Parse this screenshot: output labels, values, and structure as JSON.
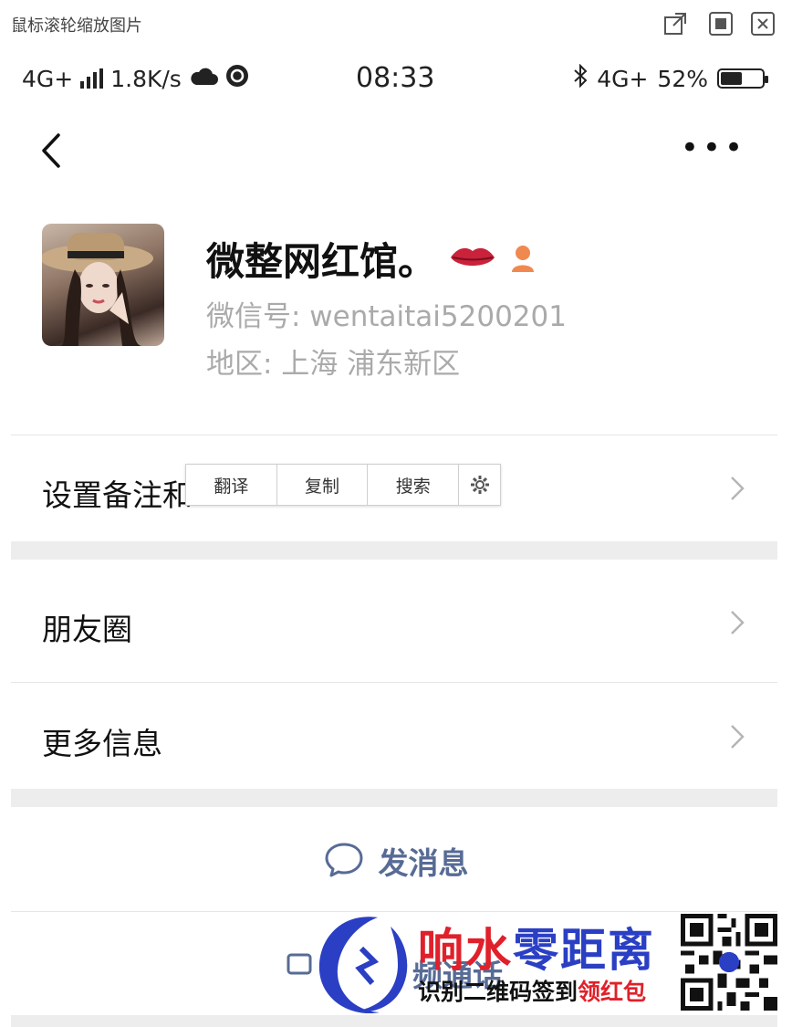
{
  "window": {
    "hint": "鼠标滚轮缩放图片"
  },
  "status_bar": {
    "network": "4G+",
    "speed": "1.8K/s",
    "time": "08:33",
    "network_right": "4G+",
    "battery": "52%",
    "battery_level": 0.52
  },
  "profile": {
    "name": "微整网红馆。",
    "wechat_id": "微信号: wentaitai5200201",
    "region": "地区: 上海  浦东新区"
  },
  "rows": {
    "remark": "设置备注和",
    "moments": "朋友圈",
    "more_info": "更多信息"
  },
  "context_menu": [
    "翻译",
    "复制",
    "搜索"
  ],
  "actions": {
    "send_message": "发消息",
    "video_call_partial": "频通话"
  },
  "watermark": {
    "title_part1": "响水",
    "title_part2": "零距离",
    "subtitle_part1": "识别二维码签到",
    "subtitle_part2": "领红包"
  },
  "colors": {
    "link": "#576b95",
    "gap": "#ededed",
    "watermark_red": "#e0202a",
    "watermark_blue": "#2b3fc4"
  }
}
